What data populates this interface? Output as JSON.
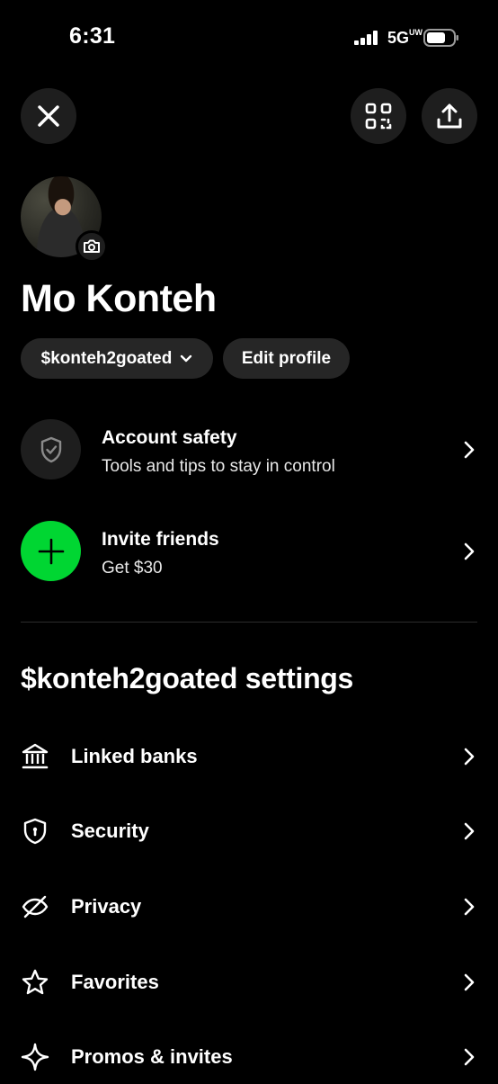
{
  "status_bar": {
    "time": "6:31",
    "network": "5G",
    "network_suffix": "UW"
  },
  "header": {
    "close_icon": "close-icon",
    "qr_icon": "qr-scan-icon",
    "share_icon": "share-icon"
  },
  "profile": {
    "name": "Mo Konteh",
    "cashtag": "$konteh2goated",
    "edit_label": "Edit profile"
  },
  "rows": [
    {
      "title": "Account safety",
      "subtitle": "Tools and tips to stay in control",
      "icon": "shield-check-icon"
    },
    {
      "title": "Invite friends",
      "subtitle": "Get $30",
      "icon": "plus-icon"
    }
  ],
  "settings": {
    "heading": "$konteh2goated settings",
    "items": [
      {
        "label": "Linked banks",
        "icon": "bank-icon"
      },
      {
        "label": "Security",
        "icon": "shield-icon"
      },
      {
        "label": "Privacy",
        "icon": "eye-slash-icon"
      },
      {
        "label": "Favorites",
        "icon": "star-icon"
      },
      {
        "label": "Promos & invites",
        "icon": "sparkle-icon"
      }
    ]
  },
  "colors": {
    "background": "#000000",
    "surface": "#1e1e1e",
    "pill": "#262626",
    "accent_green": "#00d632",
    "text": "#ffffff"
  }
}
